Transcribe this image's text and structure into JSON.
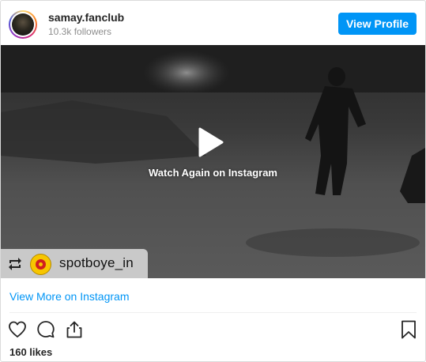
{
  "header": {
    "username": "samay.fanclub",
    "followers": "10.3k followers",
    "view_profile_label": "View Profile"
  },
  "media": {
    "overlay_text": "Watch Again on Instagram",
    "repost_account": "spotboye_in"
  },
  "footer": {
    "view_more_label": "View More on Instagram",
    "likes": "160 likes"
  },
  "colors": {
    "accent": "#0095f6",
    "text": "#262626",
    "muted": "#8e8e8e"
  },
  "icons": [
    "play-icon",
    "repost-icon",
    "heart-icon",
    "comment-icon",
    "share-icon",
    "bookmark-icon"
  ]
}
